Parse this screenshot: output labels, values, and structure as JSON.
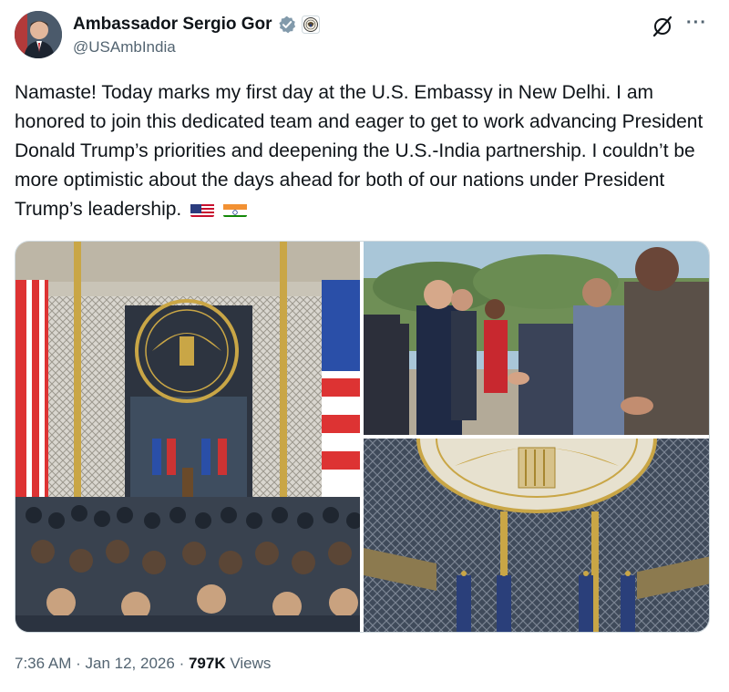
{
  "tweet": {
    "display_name": "Ambassador Sergio Gor",
    "handle": "@USAmbIndia",
    "text": "Namaste! Today marks my first day at the U.S. Embassy in New Delhi. I am honored to join this dedicated team and eager to get to work advancing President Donald Trump’s priorities and deepening the U.S.-India partnership. I couldn’t be more optimistic about the days ahead for both of our nations under President Trump’s leadership.",
    "time": "7:36 AM",
    "date": "Jan 12, 2026",
    "views_count": "797K",
    "views_label": "Views",
    "separator": "·"
  },
  "icons": {
    "verified": "verified-badge-icon",
    "affiliate": "embassy-seal-icon",
    "grok": "grok-icon",
    "more": "more-icon",
    "flags": [
      "us-flag-emoji",
      "india-flag-emoji"
    ]
  },
  "colors": {
    "text": "#0f1419",
    "secondary": "#536471",
    "verified": "#829aab",
    "border": "#cfd9de"
  }
}
